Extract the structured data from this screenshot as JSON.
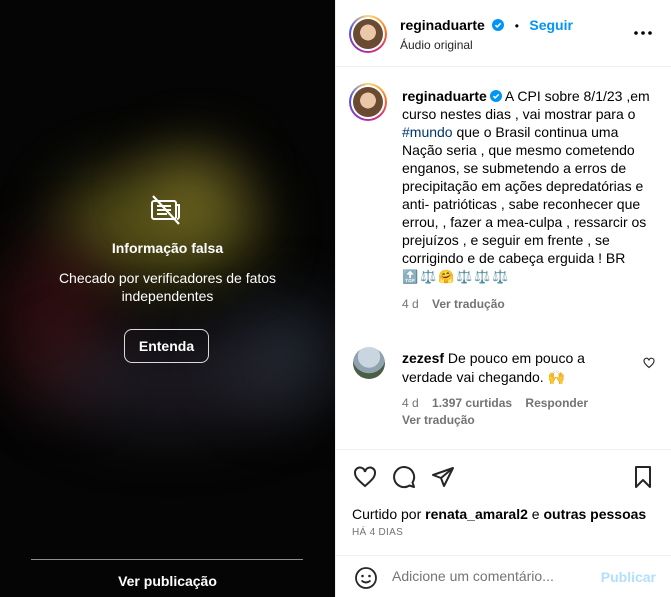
{
  "media": {
    "warning_title": "Informação falsa",
    "warning_desc": "Checado por verificadores de fatos independentes",
    "learn_button": "Entenda",
    "see_post": "Ver publicação"
  },
  "header": {
    "username": "reginaduarte",
    "separator": "•",
    "follow": "Seguir",
    "audio": "Áudio original"
  },
  "caption": {
    "username": "reginaduarte",
    "text_before_tag": " A CPI sobre 8/1/23 ,em curso nestes dias , vai mostrar para o ",
    "hashtag": "#mundo",
    "text_after_tag": " que o Brasil continua uma Nação seria , que mesmo cometendo enganos, se submetendo a erros de precipitação em ações depredatórias e anti- patrióticas , sabe reconhecer que errou, , fazer a mea-culpa , ressarcir os prejuízos , e seguir em frente , se corrigindo e de cabeça erguida ! BR",
    "emojis": [
      "🔝",
      "⚖️",
      "🤗",
      "⚖️",
      "⚖️",
      "⚖️"
    ],
    "age": "4 d",
    "translate": "Ver tradução"
  },
  "comment": {
    "username": "zezesf",
    "text": "De pouco em pouco a verdade vai chegando. 🙌",
    "age": "4 d",
    "likes": "1.397 curtidas",
    "reply": "Responder",
    "translate": "Ver tradução"
  },
  "actions": {
    "liked_by_prefix": "Curtido por ",
    "liked_by_user": "renata_amaral2",
    "liked_by_mid": " e ",
    "liked_by_others": "outras pessoas",
    "time_ago": "HÁ 4 DIAS",
    "comment_placeholder": "Adicione um comentário...",
    "post_button": "Publicar"
  },
  "colors": {
    "accent": "#0095f6",
    "verified": "#0095f6",
    "hashtag": "#00376b",
    "muted": "#737373"
  }
}
